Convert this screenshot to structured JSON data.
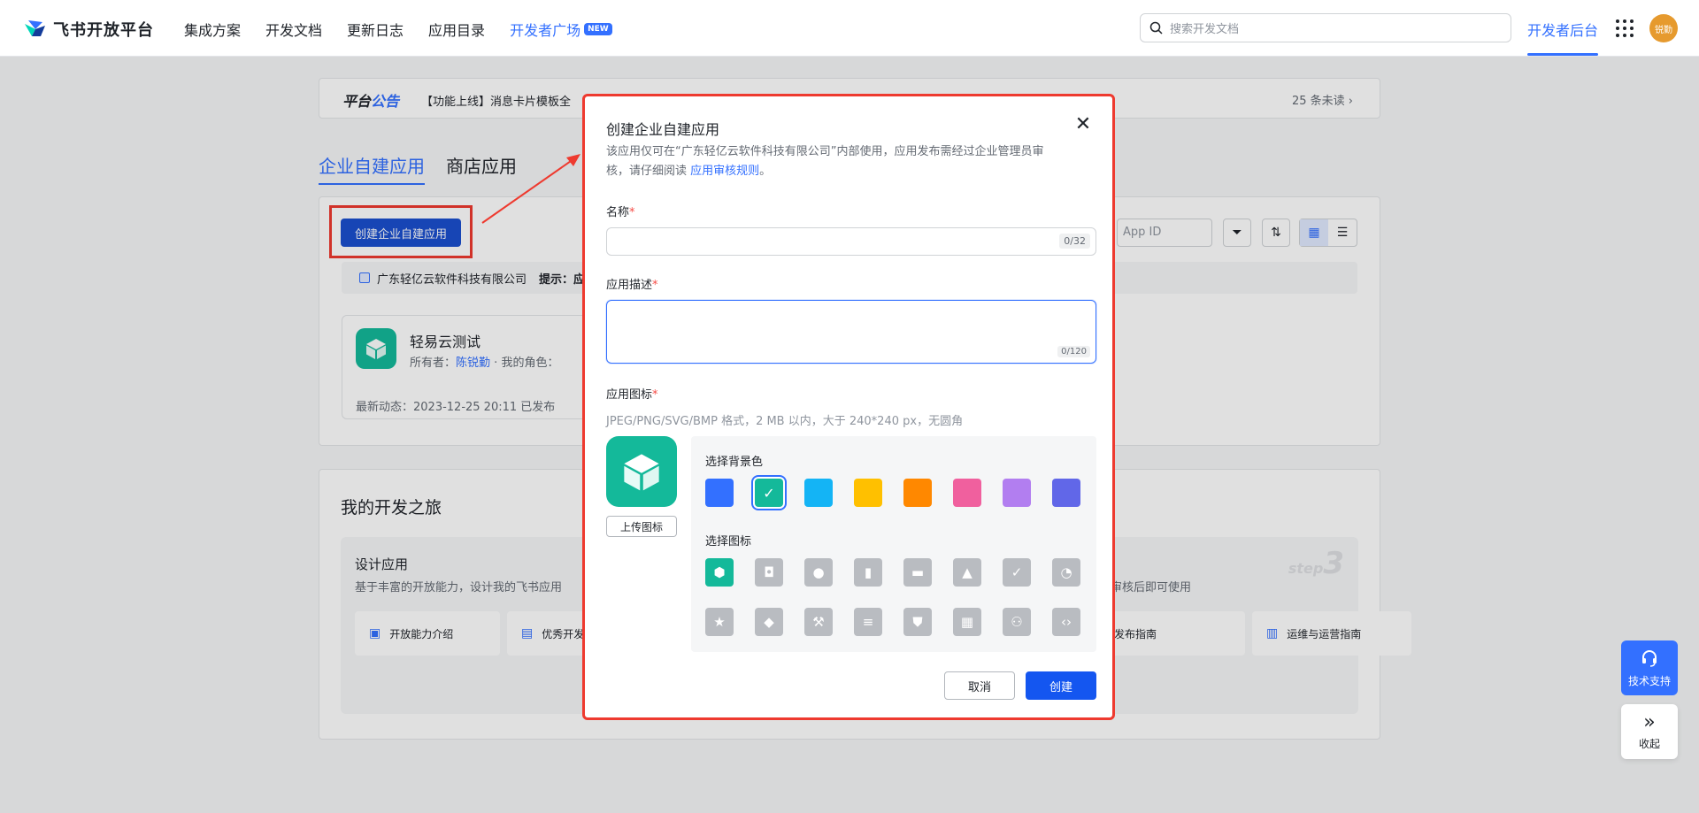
{
  "header": {
    "brand": "飞书开放平台",
    "nav": [
      "集成方案",
      "开发文档",
      "更新日志",
      "应用目录"
    ],
    "dev_square": "开发者广场",
    "new_badge": "NEW",
    "search_placeholder": "搜索开发文档",
    "dev_backend": "开发者后台",
    "avatar_text": "锐勤"
  },
  "notice": {
    "title_prefix": "平台",
    "title_accent": "公告",
    "text": "【功能上线】消息卡片模板全",
    "unread": "25 条未读"
  },
  "tabs": {
    "custom": "企业自建应用",
    "store": "商店应用"
  },
  "apps_panel": {
    "create_button": "创建企业自建应用",
    "filter_placeholder": "App ID",
    "company": "广东轻亿云软件科技有限公司",
    "tip": "提示：应",
    "app": {
      "name": "轻易云测试",
      "owner_label": "所有者：",
      "owner": "陈锐勤",
      "role_label": "我的角色：",
      "activity": "最新动态：2023-12-25 20:11   已发布"
    }
  },
  "journey": {
    "title": "我的开发之旅",
    "stage_title": "设计应用",
    "stage_desc": "基于丰富的开放能力，设计我的飞书应用",
    "stage_desc_right": "审核后即可使用",
    "step_label": "step",
    "step_num": "3",
    "guides": [
      "开放能力介绍",
      "优秀开发",
      "发布指南",
      "运维与运营指南"
    ]
  },
  "modal": {
    "title": "创建企业自建应用",
    "desc": "该应用仅可在“广东轻亿云软件科技有限公司”内部使用，应用发布需经过企业管理员审核，请仔细阅读 ",
    "desc_link": "应用审核规则",
    "desc_end": "。",
    "name_label": "名称",
    "name_counter": "0/32",
    "desc_label": "应用描述",
    "desc_counter": "0/120",
    "icon_label": "应用图标",
    "icon_hint": "JPEG/PNG/SVG/BMP 格式，2 MB 以内，大于 240*240 px，无圆角",
    "upload": "上传图标",
    "bg_label": "选择背景色",
    "icon_pick_label": "选择图标",
    "cancel": "取消",
    "create": "创建",
    "required_mark": "*",
    "bg_colors": [
      "#3370ff",
      "#14b99a",
      "#14b4f5",
      "#ffc000",
      "#ff8800",
      "#f0609e",
      "#b27ef0",
      "#6167e8"
    ],
    "selected_bg": 1,
    "icons": [
      "cube-icon",
      "robot-icon",
      "bulb-icon",
      "book-icon",
      "briefcase-icon",
      "bell-icon",
      "bookmark-check-icon",
      "pie-chart-icon",
      "star-icon",
      "tag-icon",
      "wrench-icon",
      "document-icon",
      "shield-check-icon",
      "layout-icon",
      "users-icon",
      "code-icon"
    ]
  },
  "floats": {
    "support": "技术支持",
    "collapse": "收起"
  }
}
